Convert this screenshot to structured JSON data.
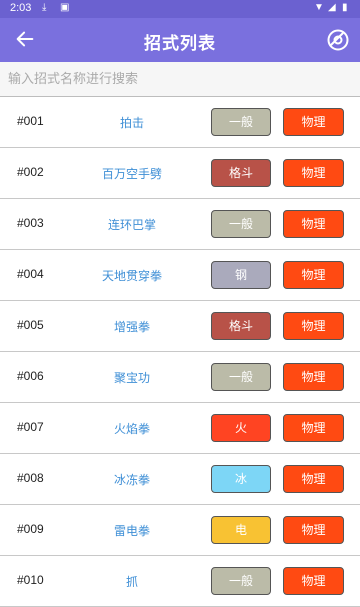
{
  "statusbar": {
    "time": "2:03"
  },
  "appbar": {
    "title": "招式列表"
  },
  "search": {
    "placeholder": "输入招式名称进行搜索"
  },
  "moves": [
    {
      "num": "#001",
      "name": "拍击",
      "type": "一般",
      "type_bg": "#bbbba8",
      "type_fg": "#ffffff",
      "category": "物理"
    },
    {
      "num": "#002",
      "name": "百万空手劈",
      "type": "格斗",
      "type_bg": "#b85248",
      "type_fg": "#ffffff",
      "category": "物理"
    },
    {
      "num": "#003",
      "name": "连环巴掌",
      "type": "一般",
      "type_bg": "#bbbba8",
      "type_fg": "#ffffff",
      "category": "物理"
    },
    {
      "num": "#004",
      "name": "天地贯穿拳",
      "type": "钢",
      "type_bg": "#aaaabc",
      "type_fg": "#ffffff",
      "category": "物理"
    },
    {
      "num": "#005",
      "name": "增强拳",
      "type": "格斗",
      "type_bg": "#b85248",
      "type_fg": "#ffffff",
      "category": "物理"
    },
    {
      "num": "#006",
      "name": "聚宝功",
      "type": "一般",
      "type_bg": "#bbbba8",
      "type_fg": "#ffffff",
      "category": "物理"
    },
    {
      "num": "#007",
      "name": "火焰拳",
      "type": "火",
      "type_bg": "#ff4422",
      "type_fg": "#ffffff",
      "category": "物理"
    },
    {
      "num": "#008",
      "name": "冰冻拳",
      "type": "冰",
      "type_bg": "#7dd6f6",
      "type_fg": "#ffffff",
      "category": "物理"
    },
    {
      "num": "#009",
      "name": "雷电拳",
      "type": "电",
      "type_bg": "#f8c233",
      "type_fg": "#ffffff",
      "category": "物理"
    },
    {
      "num": "#010",
      "name": "抓",
      "type": "一般",
      "type_bg": "#bbbba8",
      "type_fg": "#ffffff",
      "category": "物理"
    }
  ]
}
